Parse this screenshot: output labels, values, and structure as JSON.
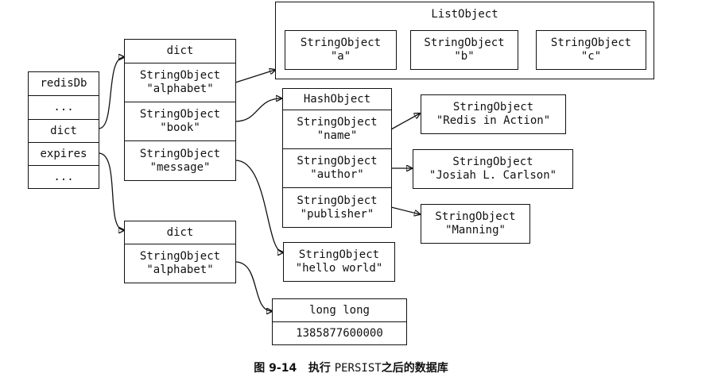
{
  "redisDb": {
    "header": "redisDb",
    "row1": "...",
    "dict": "dict",
    "expires": "expires",
    "row4": "..."
  },
  "dict_main": {
    "header": "dict",
    "keys": [
      {
        "type": "StringObject",
        "value": "\"alphabet\""
      },
      {
        "type": "StringObject",
        "value": "\"book\""
      },
      {
        "type": "StringObject",
        "value": "\"message\""
      }
    ]
  },
  "list_object": {
    "title": "ListObject",
    "items": [
      {
        "type": "StringObject",
        "value": "\"a\""
      },
      {
        "type": "StringObject",
        "value": "\"b\""
      },
      {
        "type": "StringObject",
        "value": "\"c\""
      }
    ]
  },
  "hash_object": {
    "header": "HashObject",
    "fields": [
      {
        "type": "StringObject",
        "value": "\"name\""
      },
      {
        "type": "StringObject",
        "value": "\"author\""
      },
      {
        "type": "StringObject",
        "value": "\"publisher\""
      }
    ],
    "values": [
      {
        "type": "StringObject",
        "value": "\"Redis in Action\""
      },
      {
        "type": "StringObject",
        "value": "\"Josiah L. Carlson\""
      },
      {
        "type": "StringObject",
        "value": "\"Manning\""
      }
    ]
  },
  "message_value": {
    "type": "StringObject",
    "value": "\"hello world\""
  },
  "dict_expires": {
    "header": "dict",
    "keys": [
      {
        "type": "StringObject",
        "value": "\"alphabet\""
      }
    ]
  },
  "long_long": {
    "header": "long long",
    "value": "1385877600000"
  },
  "caption": {
    "figure": "图 9-14",
    "text_before": "执行",
    "command": "PERSIST",
    "text_after": "之后的数据库"
  }
}
